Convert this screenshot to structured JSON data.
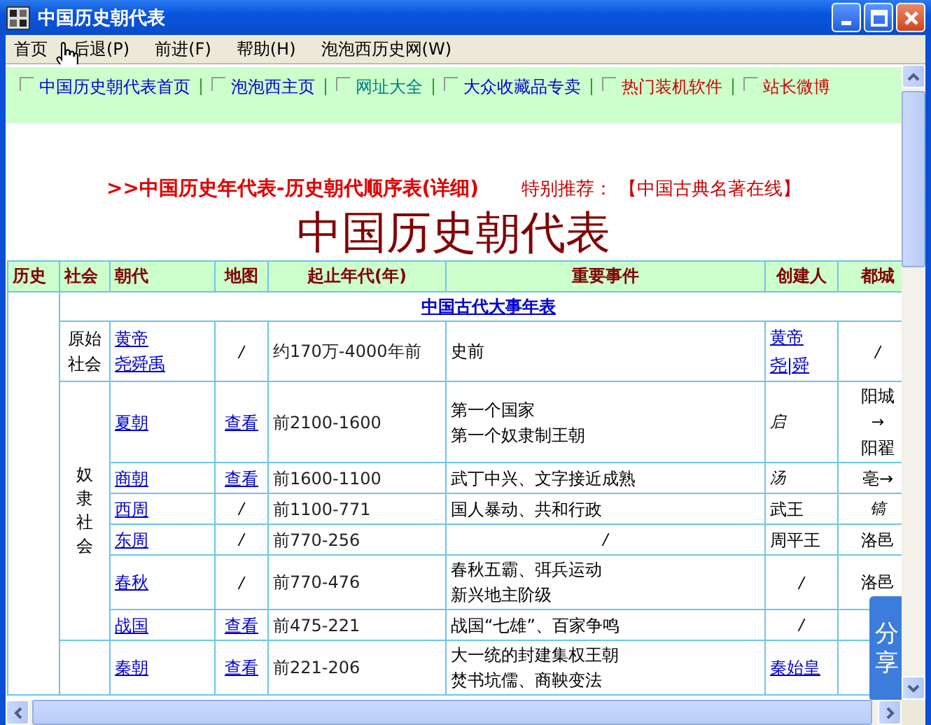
{
  "window": {
    "title": "中国历史朝代表"
  },
  "menu": [
    "首页",
    "后退(P)",
    "前进(F)",
    "帮助(H)",
    "泡泡西历史网(W)"
  ],
  "nav_links": [
    {
      "label": "中国历史朝代表首页",
      "color": "#0000cc"
    },
    {
      "label": "泡泡西主页",
      "color": "#0000cc"
    },
    {
      "label": "网址大全",
      "color": "#008080"
    },
    {
      "label": "大众收藏品专卖",
      "color": "#0000cc"
    },
    {
      "label": "热门装机软件",
      "color": "#cc0000"
    },
    {
      "label": "站长微博",
      "color": "#cc0000"
    }
  ],
  "heading": {
    "link": ">>中国历史年代表-历史朝代顺序表(详细)",
    "recommend_label": "特别推荐：",
    "recommend_link": "【中国古典名著在线】"
  },
  "page_title": "中国历史朝代表",
  "table": {
    "columns": [
      "历史",
      "社会",
      "朝代",
      "地图",
      "起止年代(年)",
      "重要事件",
      "创建人",
      "都城"
    ],
    "section_title": "中国古代大事年表",
    "groups": [
      {
        "society": "原始社会",
        "rows": [
          {
            "dynasty": [
              "黄帝",
              "尧舜禹"
            ],
            "map": {
              "text": "/",
              "link": false
            },
            "period": "约170万-4000年前",
            "events": [
              "史前"
            ],
            "founder": {
              "lines": [
                "黄帝",
                "尧|舜"
              ],
              "link": true
            },
            "capital": [
              "/"
            ]
          }
        ]
      },
      {
        "society": "奴隶社会",
        "rows": [
          {
            "dynasty": [
              "夏朝"
            ],
            "map": {
              "text": "查看",
              "link": true
            },
            "period": "前2100-1600",
            "events": [
              "第一个国家",
              "第一个奴隶制王朝"
            ],
            "founder": {
              "lines": [
                "启"
              ],
              "link": false
            },
            "capital": [
              "阳城",
              "→",
              "阳翟"
            ]
          },
          {
            "dynasty": [
              "商朝"
            ],
            "map": {
              "text": "查看",
              "link": true
            },
            "period": "前1600-1100",
            "events": [
              "武丁中兴、文字接近成熟"
            ],
            "founder": {
              "lines": [
                "汤"
              ],
              "link": false
            },
            "capital": [
              "亳→"
            ]
          },
          {
            "dynasty": [
              "西周"
            ],
            "map": {
              "text": "/",
              "link": false
            },
            "period": "前1100-771",
            "events": [
              "国人暴动、共和行政"
            ],
            "founder": {
              "lines": [
                "武王"
              ],
              "link": false
            },
            "capital": [
              "镐"
            ]
          },
          {
            "dynasty": [
              "东周"
            ],
            "map": {
              "text": "/",
              "link": false
            },
            "period": "前770-256",
            "events": [
              "/"
            ],
            "founder": {
              "lines": [
                "周平王"
              ],
              "link": false
            },
            "capital": [
              "洛邑"
            ]
          },
          {
            "dynasty": [
              "春秋"
            ],
            "map": {
              "text": "/",
              "link": false
            },
            "period": "前770-476",
            "events": [
              "春秋五霸、弭兵运动",
              "新兴地主阶级"
            ],
            "founder": {
              "lines": [
                "/"
              ],
              "link": false
            },
            "capital": [
              "洛邑"
            ]
          },
          {
            "dynasty": [
              "战国"
            ],
            "map": {
              "text": "查看",
              "link": true
            },
            "period": "前475-221",
            "events": [
              "战国“七雄”、百家争鸣"
            ],
            "founder": {
              "lines": [
                "/"
              ],
              "link": false
            },
            "capital": []
          }
        ]
      },
      {
        "rows": [
          {
            "dynasty": [
              "秦朝"
            ],
            "map": {
              "text": "查看",
              "link": true
            },
            "period": "前221-206",
            "events": [
              "大一统的封建集权王朝",
              "焚书坑儒、商鞅变法"
            ],
            "founder": {
              "lines": [
                "秦始皇"
              ],
              "link": true
            },
            "capital": []
          }
        ]
      }
    ]
  },
  "share_button": "分享"
}
